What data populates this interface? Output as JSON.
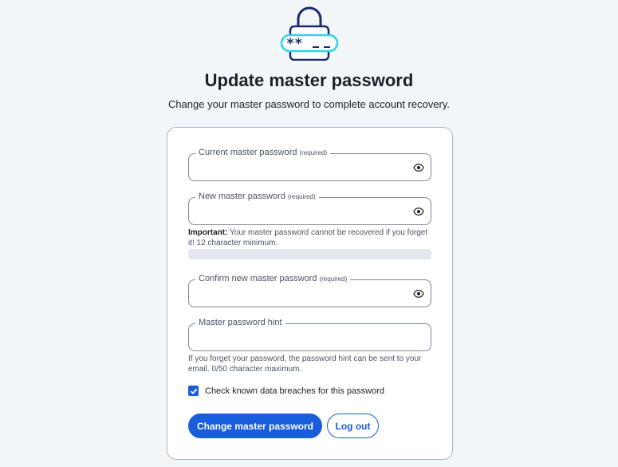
{
  "header": {
    "logo_icon": "lock-password-icon",
    "title": "Update master password",
    "subtitle": "Change your master password to complete account recovery."
  },
  "form": {
    "required_tag": "(required)",
    "current_password": {
      "label": "Current master password",
      "value": "",
      "reveal_icon": "eye-icon"
    },
    "new_password": {
      "label": "New master password",
      "value": "",
      "reveal_icon": "eye-icon",
      "important_label": "Important:",
      "important_text": " Your master password cannot be recovered if you forget it! 12 character minimum.",
      "strength": 0
    },
    "confirm_password": {
      "label": "Confirm new master password",
      "value": "",
      "reveal_icon": "eye-icon"
    },
    "password_hint": {
      "label": "Master password hint",
      "value": "",
      "help_text": "If you forget your password, the password hint can be sent to your email. 0/50 character maximum."
    },
    "breach_check": {
      "label": "Check known data breaches for this password",
      "checked": true
    },
    "submit_label": "Change master password",
    "logout_label": "Log out"
  },
  "colors": {
    "accent": "#175ddc",
    "logo_navy": "#1a2b6d",
    "logo_cyan": "#2ad4f0",
    "background": "#f3f6f9"
  }
}
